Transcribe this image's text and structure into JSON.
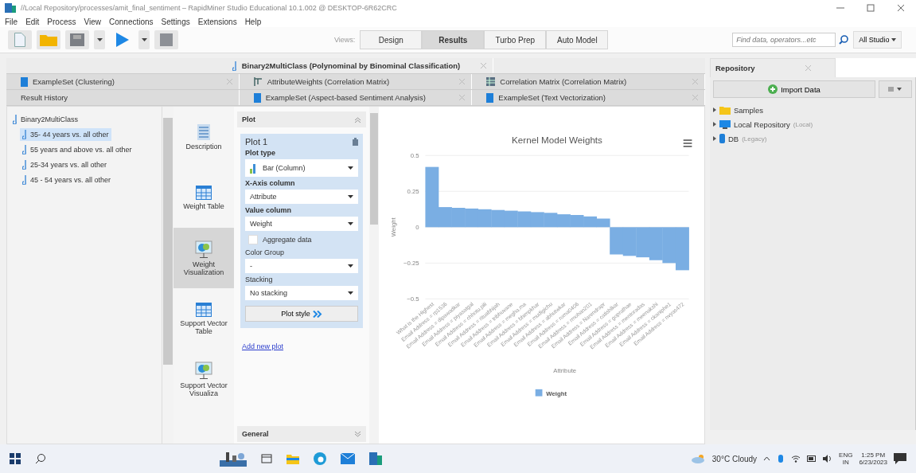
{
  "window": {
    "title": "//Local Repository/processes/amit_final_sentiment – RapidMiner Studio Educational 10.1.002 @ DESKTOP-6R62CRC"
  },
  "menu": [
    "File",
    "Edit",
    "Process",
    "View",
    "Connections",
    "Settings",
    "Extensions",
    "Help"
  ],
  "views": {
    "label": "Views:",
    "items": [
      {
        "label": "Design",
        "selected": false
      },
      {
        "label": "Results",
        "selected": true
      },
      {
        "label": "Turbo Prep",
        "selected": false
      },
      {
        "label": "Auto Model",
        "selected": false
      }
    ]
  },
  "search": {
    "placeholder": "Find data, operators...etc",
    "scope": "All Studio"
  },
  "result_tabs": [
    [
      {
        "label": "Binary2MultiClass (Polynominal by Binominal Classification)",
        "kind": "model",
        "selected": true,
        "closable": true
      }
    ],
    [
      {
        "label": "ExampleSet (Clustering)",
        "kind": "table",
        "selected": false,
        "closable": true
      },
      {
        "label": "AttributeWeights (Correlation Matrix)",
        "kind": "weights",
        "selected": false,
        "closable": true
      },
      {
        "label": "Correlation Matrix (Correlation Matrix)",
        "kind": "matrix",
        "selected": false,
        "closable": true
      }
    ],
    [
      {
        "label": "Result History",
        "kind": "plain",
        "selected": false,
        "closable": false
      },
      {
        "label": "ExampleSet (Aspect-based Sentiment Analysis)",
        "kind": "table",
        "selected": false,
        "closable": true
      },
      {
        "label": "ExampleSet (Text Vectorization)",
        "kind": "table",
        "selected": false,
        "closable": true
      }
    ]
  ],
  "history": [
    {
      "label": "Binary2MultiClass",
      "selected": false,
      "children": [
        {
          "label": "35- 44 years vs. all other",
          "selected": true
        },
        {
          "label": "55 years and above vs. all other",
          "selected": false
        },
        {
          "label": "25-34 years vs. all other",
          "selected": false
        },
        {
          "label": "45 - 54 years vs. all other",
          "selected": false
        }
      ]
    }
  ],
  "view_modes": [
    {
      "label": "Description",
      "kind": "description",
      "selected": false
    },
    {
      "label": "Weight Table",
      "kind": "table",
      "selected": false
    },
    {
      "label": "Weight Visualization",
      "kind": "chart",
      "selected": true
    },
    {
      "label": "Support Vector Table",
      "kind": "table",
      "selected": false
    },
    {
      "label": "Support Vector Visualiza",
      "kind": "chart",
      "selected": false
    }
  ],
  "plot_panel": {
    "title": "Plot",
    "plot_name": "Plot 1",
    "fields": [
      {
        "label": "Plot type",
        "kind": "select",
        "value": "Bar (Column)",
        "bold": true
      },
      {
        "label": "X-Axis column",
        "kind": "select",
        "value": "Attribute",
        "bold": true
      },
      {
        "label": "Value column",
        "kind": "select",
        "value": "Weight",
        "bold": true
      },
      {
        "label": "Aggregate data",
        "kind": "checkbox",
        "checked": false
      },
      {
        "label": "Color Group",
        "kind": "select",
        "value": "-",
        "bold": false
      },
      {
        "label": "Stacking",
        "kind": "select",
        "value": "No stacking",
        "bold": false
      }
    ],
    "style_button": "Plot style",
    "add_link": "Add new plot",
    "general": "General"
  },
  "chart": {
    "chart_data": {
      "type": "bar",
      "title": "Kernel Model Weights",
      "xlabel": "Attribute",
      "ylabel": "Weight",
      "categories": [
        "What is the Highest",
        "Email Address = rp1536",
        "Email Address = dipawadkar",
        "Email Address = piyasatgal",
        "Email Address = chhotu.pili",
        "Email Address = rituabhijah",
        "Email Address = tribhuvane",
        "Email Address = megha.ma",
        "Email Address = bhimpkhar",
        "Email Address = mudigichu",
        "Email Address = abhutwkar",
        "Email Address = roma0406",
        "Email Address = rmohan201",
        "Email Address = Narendrapr",
        "Email Address = catishlkar",
        "Email Address = goprathae",
        "Email Address = mentoradas",
        "Email Address = meenakshi",
        "Email Address = ckaniphe1",
        "Email Address = nvyas472"
      ],
      "series": [
        {
          "name": "Weight",
          "color": "#7aaee3",
          "values": [
            0.42,
            0.14,
            0.135,
            0.13,
            0.125,
            0.12,
            0.115,
            0.11,
            0.105,
            0.1,
            0.09,
            0.085,
            0.075,
            0.06,
            -0.19,
            -0.2,
            -0.21,
            -0.23,
            -0.25,
            -0.3
          ]
        }
      ],
      "grid": true,
      "ylim": [
        -0.5,
        0.5
      ],
      "yticks": [
        {
          "value": 0.5,
          "label": "0.5"
        },
        {
          "value": 0.25,
          "label": "0.25"
        },
        {
          "value": 0,
          "label": "0"
        },
        {
          "value": -0.25,
          "label": "−0.25"
        },
        {
          "value": -0.5,
          "label": "−0.5"
        }
      ]
    }
  },
  "repository": {
    "title": "Repository",
    "import_button": "Import Data",
    "items": [
      {
        "label": "Samples",
        "kind": "folder"
      },
      {
        "label": "Local Repository",
        "kind": "local",
        "note": "(Local)"
      },
      {
        "label": "DB",
        "kind": "db",
        "note": "(Legacy)"
      }
    ]
  },
  "taskbar": {
    "weather": "30°C Cloudy",
    "lang": "ENG",
    "region": "IN",
    "time": "1:25 PM",
    "date": "6/23/2023"
  }
}
